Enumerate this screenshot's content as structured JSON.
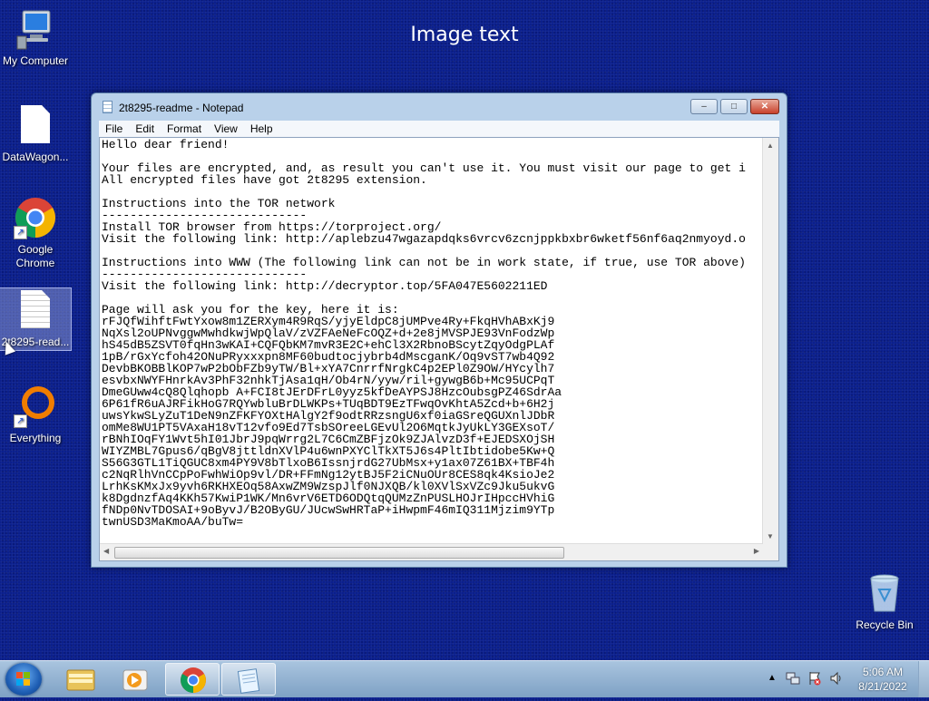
{
  "wallpaper": {
    "caption": "Image text",
    "color": "#0b1f8c"
  },
  "desktop_icons": [
    {
      "label": "My Computer",
      "icon": "computer-icon"
    },
    {
      "label": "DataWagon...",
      "icon": "file-icon"
    },
    {
      "label": "Google Chrome",
      "icon": "chrome-icon"
    },
    {
      "label": "2t8295-read...",
      "icon": "text-file-icon"
    },
    {
      "label": "Everything",
      "icon": "everything-search-icon"
    },
    {
      "label": "Recycle Bin",
      "icon": "recycle-bin-icon"
    }
  ],
  "notepad": {
    "title": "2t8295-readme - Notepad",
    "buttons": {
      "minimize": "–",
      "maximize": "□",
      "close": "✕"
    },
    "menu": [
      "File",
      "Edit",
      "Format",
      "View",
      "Help"
    ],
    "content": "Hello dear friend!\n\nYour files are encrypted, and, as result you can't use it. You must visit our page to get i\nAll encrypted files have got 2t8295 extension.\n\nInstructions into the TOR network\n-----------------------------\nInstall TOR browser from https://torproject.org/\nVisit the following link: http://aplebzu47wgazapdqks6vrcv6zcnjppkbxbr6wketf56nf6aq2nmyoyd.o\n\nInstructions into WWW (The following link can not be in work state, if true, use TOR above)\n-----------------------------\nVisit the following link: http://decryptor.top/5FA047E5602211ED\n\nPage will ask you for the key, here it is:\nrFJQfWihftFwtYxow8m1ZERXym4R9RqS/yjyEldpC8jUMPve4Ry+FkqHVhABxKj9\nNqXsl2oUPNvggwMwhdkwjWpQlaV/zVZFAeNeFcOQZ+d+2e8jMVSPJE93VnFodzWp\nhS45dB5ZSVT0fqHn3wKAI+CQFQbKM7mvR3E2C+ehCl3X2RbnoBScytZqyOdgPLAf\n1pB/rGxYcfoh42ONuPRyxxxpn8MF60budtocjybrb4dMscganK/Oq9vST7wb4Q92\nDevbBKOBBlKOP7wP2bObFZb9yTW/Bl+xYA7CnrrfNrgkC4p2EPl0Z9OW/HYcylh7\nesvbxNWYFHnrkAv3PhF32nhkTjAsa1qH/Ob4rN/yyw/ril+gywgB6b+Mc95UCPqT\nDmeGUww4cQ8Qlqhopb A+FCI8tJErDFrL0yyz5kfDeAYPSJ8HzcOubsgPZ46SdrAa\n6P61fR6uAJRFikHoG7RQYwbluBrDLWKPs+TUqBDT9EzTFwqOvKhtA5Zcd+b+6H2j\nuwsYkwSLyZuT1DeN9nZFKFYOXtHAlgY2f9odtRRzsngU6xf0iaGSreQGUXnlJDbR\nomMe8WU1PT5VAxaH18vT12vfo9Ed7TsbSOreeLGEvUl2O6MqtkJyUkLY3GEXsoT/\nrBNhIOqFY1Wvt5hI01JbrJ9pqWrrg2L7C6CmZBFjzOk9ZJAlvzD3f+EJEDSXOjSH\nWIYZMBL7Gpus6/qBgV8jttldnXVlP4u6wnPXYClTkXT5J6s4PltIbtidobe5Kw+Q\nS56G3GTL1TiQGUC8xm4PY9V8bTlxoB6IssnjrdG27UbMsx+y1ax07Z61BX+TBF4h\nc2NqRlhVnCCpPoFwhWiOp9vl/DR+FFmNg12ytBJ5F2iCNuOUr8CES8qk4KsioJe2\nLrhKsKMxJx9yvh6RKHXEOq58AxwZM9WzspJlf0NJXQB/kl0XVlSxVZc9Jku5ukvG\nk8DgdnzfAq4KKh57KwiP1WK/Mn6vrV6ETD6ODQtqQUMzZnPUSLHOJrIHpccHVhiG\nfNDp0NvTDOSAI+9oByvJ/B2OByGU/JUcwSwHRTaP+iHwpmF46mIQ311Mjzim9YTp\ntwnUSD3MaKmoAA/buTw="
  },
  "taskbar": {
    "clock_time": "5:06 AM",
    "clock_date": "8/21/2022",
    "pinned": [
      "explorer-icon",
      "media-player-icon",
      "chrome-icon",
      "notepad-icon"
    ],
    "tray_icons": [
      "show-hidden-icons-chevron-icon",
      "network-icon",
      "action-center-icon",
      "volume-icon"
    ]
  }
}
